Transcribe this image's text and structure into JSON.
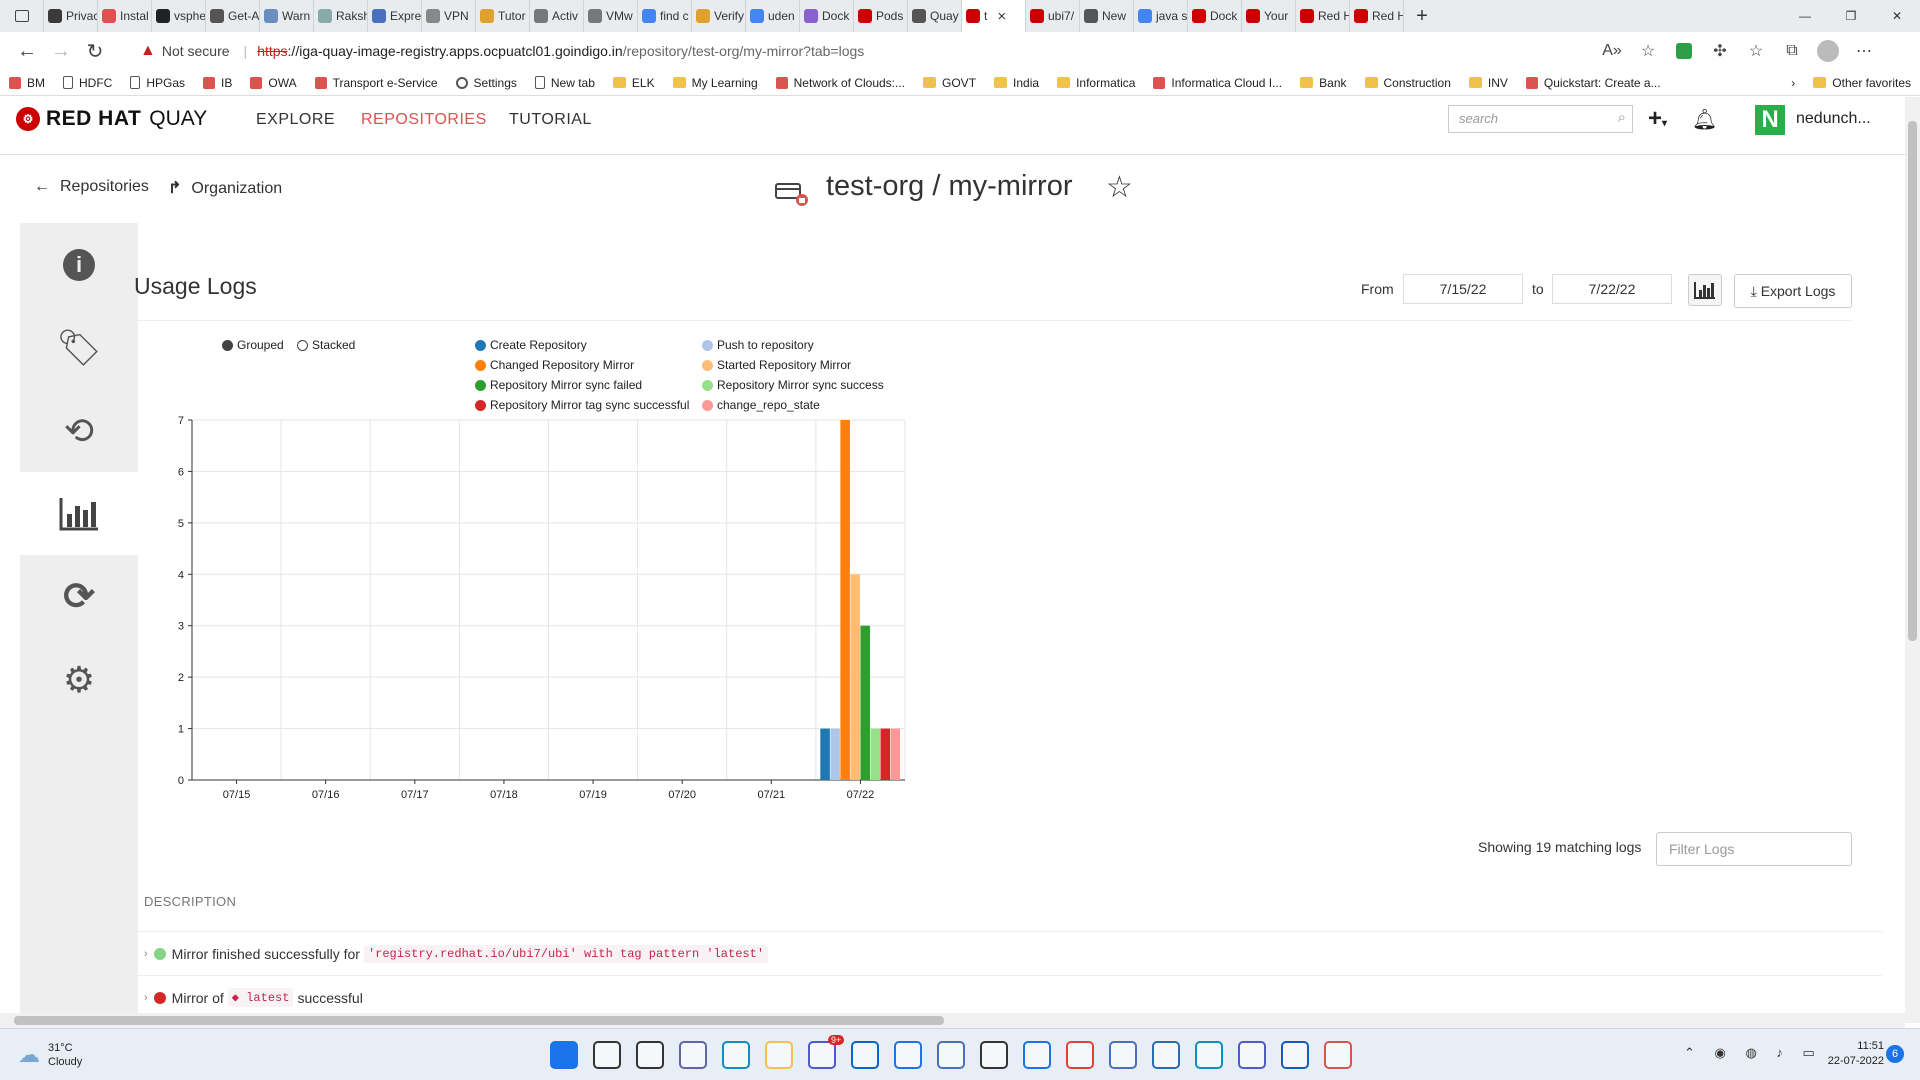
{
  "browser": {
    "tabs": [
      {
        "label": "Privacy er",
        "color": "#3a3a3a"
      },
      {
        "label": "Instal",
        "color": "#e05050"
      },
      {
        "label": "vsphe",
        "color": "#222"
      },
      {
        "label": "Get-A",
        "color": "#555"
      },
      {
        "label": "Warn",
        "color": "#6a8fbf"
      },
      {
        "label": "Raksh",
        "color": "#8aa"
      },
      {
        "label": "Expre",
        "color": "#4a6fbf"
      },
      {
        "label": "VPN",
        "color": "#888"
      },
      {
        "label": "Tutor",
        "color": "#e0a030"
      },
      {
        "label": "Activ",
        "color": "#777"
      },
      {
        "label": "VMw",
        "color": "#777"
      },
      {
        "label": "find c",
        "color": "#4285f4"
      },
      {
        "label": "Verify",
        "color": "#e0a030"
      },
      {
        "label": "uden",
        "color": "#4285f4"
      },
      {
        "label": "Dock",
        "color": "#8a5fd0"
      },
      {
        "label": "Pods",
        "color": "#cc0000"
      },
      {
        "label": "Quay",
        "color": "#555"
      },
      {
        "label": "t",
        "color": "#cc0000"
      },
      {
        "label": "ubi7/",
        "color": "#cc0000"
      },
      {
        "label": "New",
        "color": "#555"
      },
      {
        "label": "java s",
        "color": "#4285f4"
      },
      {
        "label": "Dock",
        "color": "#cc0000"
      },
      {
        "label": "Your",
        "color": "#cc0000"
      },
      {
        "label": "Red H",
        "color": "#cc0000"
      },
      {
        "label": "Red H",
        "color": "#cc0000"
      }
    ],
    "active_tab_index": 17,
    "close_glyph": "×",
    "new_tab_glyph": "+",
    "url": {
      "not_secure": "Not secure",
      "scheme": "https",
      "host": "://iga-quay-image-registry.apps.ocpuatcl01.goindigo.in",
      "path": "/repository/test-org/my-mirror?tab=logs"
    },
    "favorites": [
      {
        "label": "BM",
        "kind": "icon"
      },
      {
        "label": "HDFC",
        "kind": "page"
      },
      {
        "label": "HPGas",
        "kind": "page"
      },
      {
        "label": "IB",
        "kind": "icon"
      },
      {
        "label": "OWA",
        "kind": "icon"
      },
      {
        "label": "Transport e-Service",
        "kind": "icon"
      },
      {
        "label": "Settings",
        "kind": "gear"
      },
      {
        "label": "New tab",
        "kind": "page"
      },
      {
        "label": "ELK",
        "kind": "folder"
      },
      {
        "label": "My Learning",
        "kind": "folder"
      },
      {
        "label": "Network of Clouds:...",
        "kind": "icon"
      },
      {
        "label": "GOVT",
        "kind": "folder"
      },
      {
        "label": "India",
        "kind": "folder"
      },
      {
        "label": "Informatica",
        "kind": "folder"
      },
      {
        "label": "Informatica Cloud I...",
        "kind": "icon"
      },
      {
        "label": "Bank",
        "kind": "folder"
      },
      {
        "label": "Construction",
        "kind": "folder"
      },
      {
        "label": "INV",
        "kind": "folder"
      },
      {
        "label": "Quickstart: Create a...",
        "kind": "icon"
      }
    ],
    "other_favorites": "Other favorites"
  },
  "quay": {
    "brand_bold": "RED HAT",
    "brand_light": "QUAY",
    "nav": [
      "EXPLORE",
      "REPOSITORIES",
      "TUTORIAL"
    ],
    "active_nav": "REPOSITORIES",
    "search_placeholder": "search",
    "user_initial": "N",
    "user_name": "nedunch...",
    "breadcrumb_repositories": "Repositories",
    "breadcrumb_organization": "Organization",
    "title": "test-org / my-mirror",
    "usage_title": "Usage Logs",
    "from_label": "From",
    "to_label": "to",
    "from_date": "7/15/22",
    "to_date": "7/22/22",
    "export_label": "Export Logs",
    "matching_text": "Showing 19 matching logs",
    "filter_placeholder": "Filter Logs",
    "description_header": "DESCRIPTION",
    "logs": [
      {
        "prefix": "Mirror finished successfully for",
        "code": "'registry.redhat.io/ubi7/ubi' with tag pattern 'latest'",
        "suffix": "",
        "status_color": "#86d486"
      },
      {
        "prefix": "Mirror of",
        "code": "latest",
        "suffix": "successful",
        "status_color": "#d62728"
      }
    ]
  },
  "chart_data": {
    "type": "bar",
    "mode_options": [
      "Grouped",
      "Stacked"
    ],
    "selected_mode": "Grouped",
    "categories": [
      "07/15",
      "07/16",
      "07/17",
      "07/18",
      "07/19",
      "07/20",
      "07/21",
      "07/22"
    ],
    "ylim": [
      0,
      7
    ],
    "yticks": [
      "0",
      "1",
      "2",
      "3",
      "4",
      "5",
      "6",
      "7"
    ],
    "legend_placement": "top",
    "grid": true,
    "series": [
      {
        "name": "Create Repository",
        "color": "#1f77b4",
        "values": [
          0,
          0,
          0,
          0,
          0,
          0,
          0,
          1
        ]
      },
      {
        "name": "Push to repository",
        "color": "#aec7e8",
        "values": [
          0,
          0,
          0,
          0,
          0,
          0,
          0,
          1
        ]
      },
      {
        "name": "Changed Repository Mirror",
        "color": "#ff7f0e",
        "values": [
          0,
          0,
          0,
          0,
          0,
          0,
          0,
          7
        ]
      },
      {
        "name": "Started Repository Mirror",
        "color": "#ffbb78",
        "values": [
          0,
          0,
          0,
          0,
          0,
          0,
          0,
          4
        ]
      },
      {
        "name": "Repository Mirror sync failed",
        "color": "#2ca02c",
        "values": [
          0,
          0,
          0,
          0,
          0,
          0,
          0,
          3
        ]
      },
      {
        "name": "Repository Mirror sync success",
        "color": "#98df8a",
        "values": [
          0,
          0,
          0,
          0,
          0,
          0,
          0,
          1
        ]
      },
      {
        "name": "Repository Mirror tag sync successful",
        "color": "#d62728",
        "values": [
          0,
          0,
          0,
          0,
          0,
          0,
          0,
          1
        ]
      },
      {
        "name": "change_repo_state",
        "color": "#ff9896",
        "values": [
          0,
          0,
          0,
          0,
          0,
          0,
          0,
          1
        ]
      }
    ]
  },
  "taskbar": {
    "weather_temp": "31°C",
    "weather_desc": "Cloudy",
    "time": "11:51",
    "date": "22-07-2022",
    "notification_count": "6",
    "teams_badge": "9+"
  }
}
